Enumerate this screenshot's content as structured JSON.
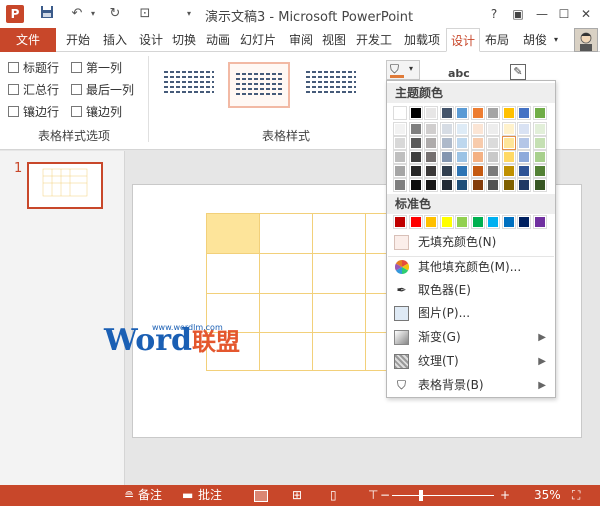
{
  "title_bar": {
    "app_icon": "P",
    "title": "演示文稿3 - Microsoft PowerPoint"
  },
  "tabs": [
    "文件",
    "开始",
    "插入",
    "设计",
    "切换",
    "动画",
    "幻灯片",
    "审阅",
    "视图",
    "开发工",
    "加载项",
    "设计",
    "布局"
  ],
  "user_name": "胡俊",
  "ribbon": {
    "options": {
      "label": "表格样式选项",
      "items": [
        "标题行",
        "第一列",
        "汇总行",
        "最后一列",
        "镶边行",
        "镶边列"
      ]
    },
    "styles_label": "表格样式",
    "text_button": "abc"
  },
  "dropdown": {
    "theme_colors_title": "主题颜色",
    "standard_colors_title": "标准色",
    "theme_row": [
      "#ffffff",
      "#000000",
      "#e7e6e6",
      "#44546a",
      "#5b9bd5",
      "#ed7d31",
      "#a5a5a5",
      "#ffc000",
      "#4472c4",
      "#70ad47"
    ],
    "theme_shades": [
      [
        "#f2f2f2",
        "#7f7f7f",
        "#d0cece",
        "#d6dce4",
        "#deebf6",
        "#fbe5d5",
        "#ededed",
        "#fff2cc",
        "#d9e2f3",
        "#e2efd9"
      ],
      [
        "#d8d8d8",
        "#595959",
        "#aeabab",
        "#adb9ca",
        "#bdd7ee",
        "#f7cbac",
        "#dbdbdb",
        "#fee599",
        "#b4c6e7",
        "#c5e0b3"
      ],
      [
        "#bfbfbf",
        "#3f3f3f",
        "#757070",
        "#8496b0",
        "#9cc3e5",
        "#f4b183",
        "#c9c9c9",
        "#ffd965",
        "#8eaadb",
        "#a8d08d"
      ],
      [
        "#a5a5a5",
        "#262626",
        "#3a3838",
        "#323f4f",
        "#2e75b5",
        "#c55a11",
        "#7b7b7b",
        "#bf9000",
        "#2f5496",
        "#538135"
      ],
      [
        "#7f7f7f",
        "#0c0c0c",
        "#171616",
        "#222a35",
        "#1e4e79",
        "#833c0b",
        "#525252",
        "#7f6000",
        "#1f3864",
        "#375623"
      ]
    ],
    "standard_row": [
      "#c00000",
      "#ff0000",
      "#ffc000",
      "#ffff00",
      "#92d050",
      "#00b050",
      "#00b0f0",
      "#0070c0",
      "#002060",
      "#7030a0"
    ],
    "no_fill": "无填充颜色(N)",
    "more_colors": "其他填充颜色(M)...",
    "eyedropper": "取色器(E)",
    "picture": "图片(P)...",
    "gradient": "渐变(G)",
    "texture": "纹理(T)",
    "table_background": "表格背景(B)"
  },
  "slides": {
    "number": "1"
  },
  "watermark": {
    "url": "www.wordlm.com",
    "word": "Word",
    "brand": "联盟"
  },
  "status_bar": {
    "notes": "备注",
    "comments": "批注",
    "zoom": "35%"
  }
}
